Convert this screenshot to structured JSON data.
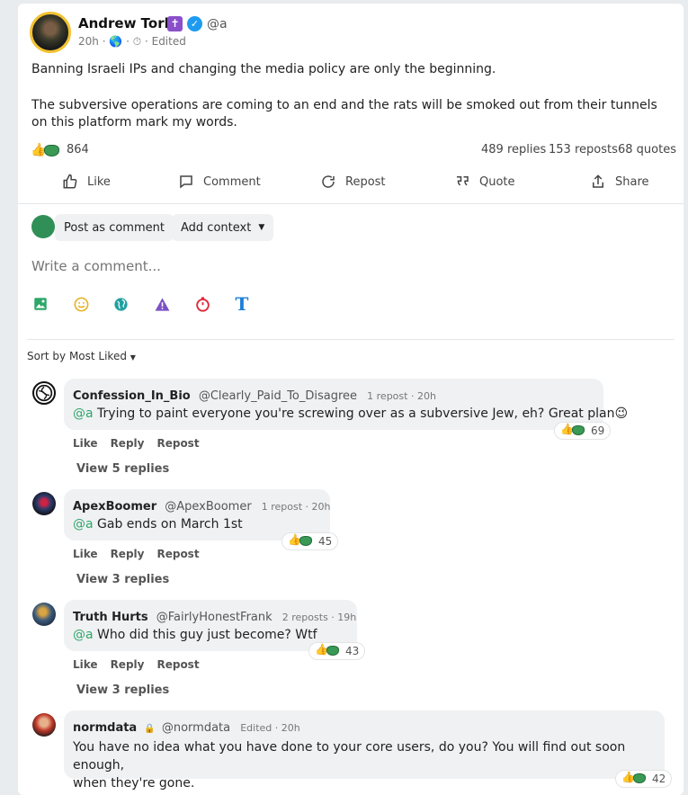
{
  "post": {
    "author_name": "Andrew Torba",
    "author_badge": "✝",
    "handle": "@a",
    "time": "20h",
    "edited": "Edited",
    "text_p1": "Banning Israeli IPs and changing the media policy are only the beginning.",
    "text_p2": "The subversive operations are coming to an end and the rats will be smoked out from their tunnels on this platform mark my words.",
    "reaction_count": "864",
    "replies": "489 replies",
    "reposts": "153 reposts",
    "quotes": "68 quotes"
  },
  "actions": {
    "like": "Like",
    "comment": "Comment",
    "repost": "Repost",
    "quote": "Quote",
    "share": "Share"
  },
  "composer": {
    "post_as": "Post as comment",
    "add_context": "Add context",
    "placeholder": "Write a comment..."
  },
  "toolbar_icons": [
    "image-icon",
    "emoji-icon",
    "globe-icon",
    "warning-icon",
    "timer-icon",
    "text-format-icon"
  ],
  "sort": {
    "label": "Sort by Most Liked"
  },
  "comments": [
    {
      "name": "Confession_In_Bio",
      "handle": "@Clearly_Paid_To_Disagree",
      "meta": "1 repost · 20h",
      "mention": "@a",
      "text": " Trying to paint everyone you're screwing over as a subversive Jew, eh? Great plan",
      "emoji": "😉",
      "count": "69",
      "like": "Like",
      "reply": "Reply",
      "repost": "Repost",
      "view_replies": "View 5 replies"
    },
    {
      "name": "ApexBoomer",
      "handle": "@ApexBoomer",
      "meta": "1 repost · 20h",
      "mention": "@a",
      "text": " Gab ends on March 1st",
      "count": "45",
      "like": "Like",
      "reply": "Reply",
      "repost": "Repost",
      "view_replies": "View 3 replies"
    },
    {
      "name": "Truth Hurts",
      "handle": "@FairlyHonestFrank",
      "meta": "2 reposts · 19h",
      "mention": "@a",
      "text": " Who did this guy just become? Wtf",
      "count": "43",
      "like": "Like",
      "reply": "Reply",
      "repost": "Repost",
      "view_replies": "View 3 replies"
    },
    {
      "name": "normdata",
      "handle": "@normdata",
      "meta": "Edited · 20h",
      "text_line1": "You have no idea what you have done to your core users, do you? You will find out soon enough,",
      "text_line2": "when they're gone.",
      "count": "42"
    }
  ],
  "colors": {
    "accent_green": "#2fa66a",
    "verified_blue": "#1d9bf0",
    "badge_purple": "#8a4fc9"
  }
}
